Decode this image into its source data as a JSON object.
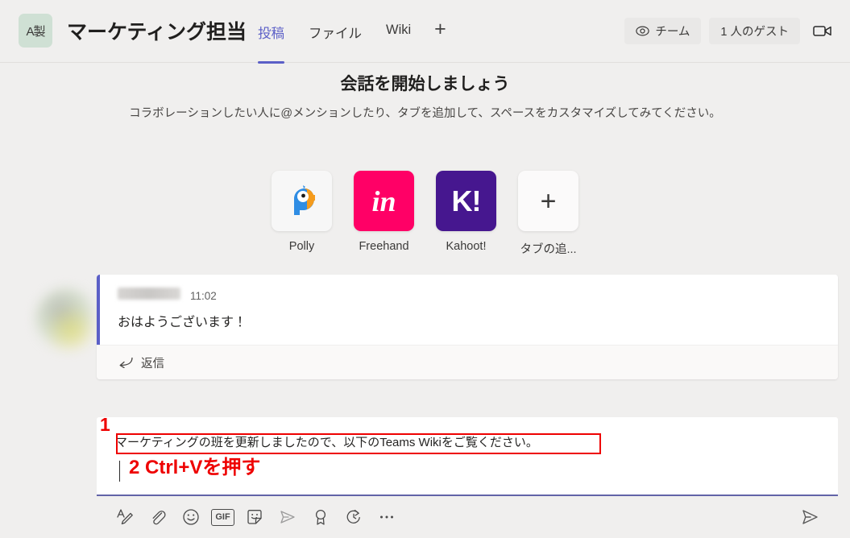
{
  "header": {
    "avatar_text": "A製",
    "team_name": "マーケティング担当",
    "tabs": [
      {
        "label": "投稿",
        "active": true
      },
      {
        "label": "ファイル",
        "active": false
      },
      {
        "label": "Wiki",
        "active": false
      }
    ],
    "add_tab_label": "+",
    "team_pill": "チーム",
    "guest_pill": "1 人のゲスト",
    "icons": {
      "team": "eye-icon",
      "video": "video-camera-icon",
      "add_tab": "plus-icon"
    }
  },
  "welcome": {
    "title": "会話を開始しましょう",
    "subtitle": "コラボレーションしたい人に@メンションしたり、タブを追加して、スペースをカスタマイズしてみてください。"
  },
  "app_tiles": [
    {
      "label": "Polly",
      "icon": "polly-parrot-icon",
      "color": "#F7F7F7"
    },
    {
      "label": "Freehand",
      "icon": "invision-in-icon",
      "color": "#FF0066"
    },
    {
      "label": "Kahoot!",
      "icon": "kahoot-k-icon",
      "color": "#46178F"
    },
    {
      "label": "タブの追...",
      "icon": "plus-icon",
      "color": "#FBFAFA"
    }
  ],
  "message": {
    "author": "",
    "time": "11:02",
    "text": "おはようございます！",
    "reply_label": "返信",
    "accent_color": "#5B5FC7"
  },
  "compose": {
    "text": "マーケティングの班を更新しましたので、以下のTeams Wikiをご覧ください。",
    "toolbar": [
      {
        "name": "format-icon",
        "title": "書式"
      },
      {
        "name": "attach-icon",
        "title": "添付"
      },
      {
        "name": "emoji-icon",
        "title": "絵文字"
      },
      {
        "name": "gif-icon",
        "title": "GIF"
      },
      {
        "name": "sticker-icon",
        "title": "ステッカー"
      },
      {
        "name": "stream-icon",
        "title": "ストリーム"
      },
      {
        "name": "praise-icon",
        "title": "称賛"
      },
      {
        "name": "schedule-icon",
        "title": "予定"
      },
      {
        "name": "more-icon",
        "title": "その他"
      }
    ],
    "send_icon": "send-icon",
    "gif_label": "GIF"
  },
  "annotations": {
    "step1": "1",
    "step2": "2 Ctrl+Vを押す",
    "color": "#EE0000"
  }
}
